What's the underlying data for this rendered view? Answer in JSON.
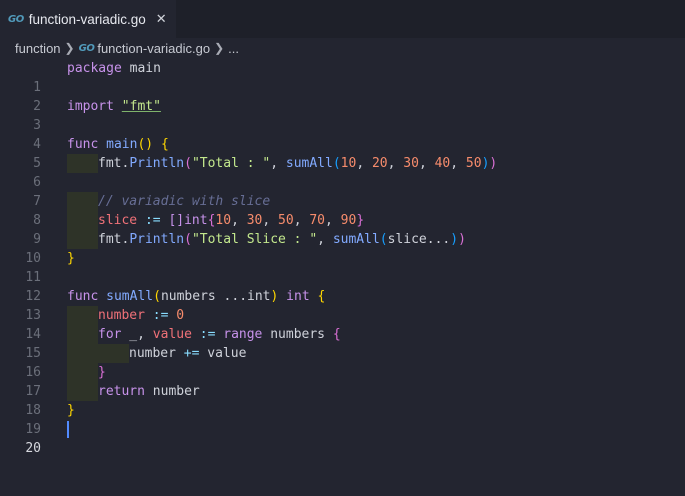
{
  "tab": {
    "icon": "go-file-icon",
    "logo_text": "GO",
    "title": "function-variadic.go",
    "close": "✕"
  },
  "breadcrumb": {
    "folder": "function",
    "file": "function-variadic.go",
    "more": "..."
  },
  "editor": {
    "line_numbers": [
      "1",
      "2",
      "3",
      "4",
      "5",
      "6",
      "7",
      "8",
      "9",
      "10",
      "11",
      "12",
      "13",
      "14",
      "15",
      "16",
      "17",
      "18",
      "19",
      "20"
    ],
    "l1": {
      "kw": "package",
      "rest": " main"
    },
    "l3": {
      "kw": "import",
      "sp": " ",
      "str": "\"fmt\""
    },
    "l5": {
      "kw": "func",
      "fn": "main",
      "p": "()",
      "sp": " ",
      "b": "{"
    },
    "l6": {
      "obj": "fmt.",
      "fn": "Println",
      "po": "(",
      "str": "\"Total : \"",
      "comma": ", ",
      "fn2": "sumAll",
      "po2": "(",
      "nums": [
        "10",
        "20",
        "30",
        "40",
        "50"
      ],
      "pc2": ")",
      "pc": ")"
    },
    "l8": {
      "comment": "// variadic with slice"
    },
    "l9": {
      "var": "slice",
      "op": " := ",
      "type": "[]int",
      "bo": "{",
      "nums": [
        "10",
        "30",
        "50",
        "70",
        "90"
      ],
      "bc": "}"
    },
    "l10": {
      "obj": "fmt.",
      "fn": "Println",
      "po": "(",
      "str": "\"Total Slice : \"",
      "comma": ", ",
      "fn2": "sumAll",
      "po2": "(",
      "arg": "slice...",
      "pc2": ")",
      "pc": ")"
    },
    "l11": {
      "b": "}"
    },
    "l13": {
      "kw": "func",
      "fn": "sumAll",
      "po": "(",
      "params": "numbers ...int",
      "pc": ")",
      "ret": " int ",
      "b": "{"
    },
    "l14": {
      "var": "number",
      "op": " := ",
      "num": "0"
    },
    "l15": {
      "kw": "for",
      "rest1": " _, ",
      "var": "value",
      "op": " := ",
      "kw2": "range",
      "rest2": " numbers ",
      "b": "{"
    },
    "l16": {
      "text1": "number ",
      "op": "+=",
      "text2": " value"
    },
    "l17": {
      "b": "}"
    },
    "l18": {
      "kw": "return",
      "rest": " number"
    },
    "l19": {
      "b": "}"
    }
  }
}
